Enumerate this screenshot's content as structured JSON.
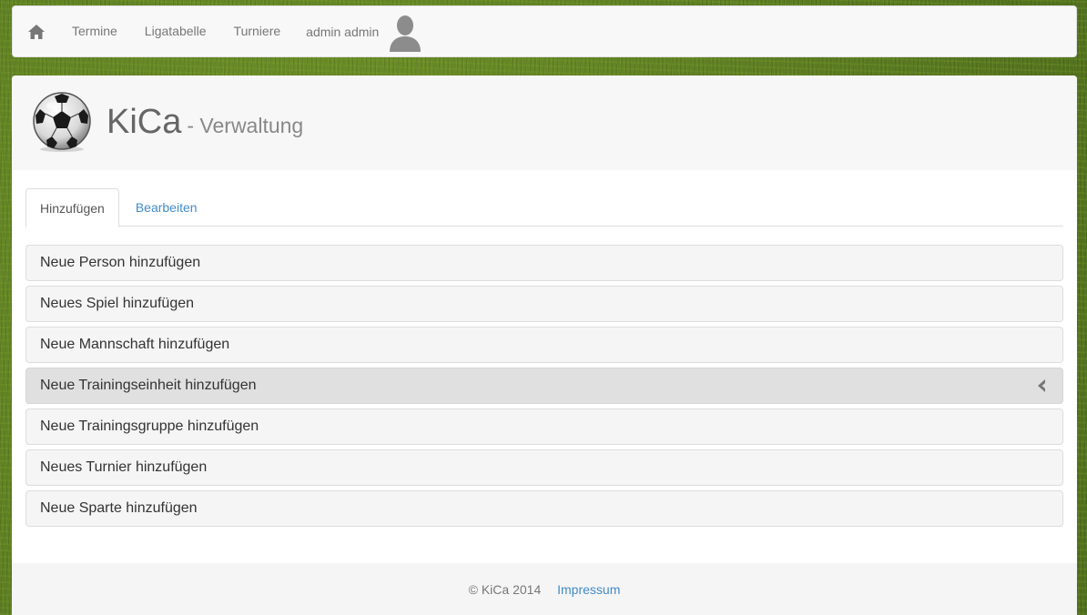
{
  "navbar": {
    "home_icon": "home-icon",
    "links": [
      {
        "label": "Termine"
      },
      {
        "label": "Ligatabelle"
      },
      {
        "label": "Turniere"
      }
    ],
    "user_name": "admin admin",
    "avatar_icon": "user-avatar-icon"
  },
  "header": {
    "logo_icon": "soccer-ball-icon",
    "title": "KiCa",
    "subtitle": "- Verwaltung"
  },
  "tabs": [
    {
      "label": "Hinzufügen",
      "active": true
    },
    {
      "label": "Bearbeiten",
      "active": false
    }
  ],
  "list": {
    "items": [
      {
        "label": "Neue Person hinzufügen",
        "active": false
      },
      {
        "label": "Neues Spiel hinzufügen",
        "active": false
      },
      {
        "label": "Neue Mannschaft hinzufügen",
        "active": false
      },
      {
        "label": "Neue Trainingseinheit hinzufügen",
        "active": true,
        "icon": "chevron-left-icon"
      },
      {
        "label": "Neue Trainingsgruppe hinzufügen",
        "active": false
      },
      {
        "label": "Neues Turnier hinzufügen",
        "active": false
      },
      {
        "label": "Neue Sparte hinzufügen",
        "active": false
      }
    ]
  },
  "footer": {
    "copyright": "© KiCa 2014",
    "impressum": "Impressum"
  },
  "colors": {
    "link": "#428bca",
    "active_item": "#e0e0e0",
    "item": "#f5f5f5"
  }
}
